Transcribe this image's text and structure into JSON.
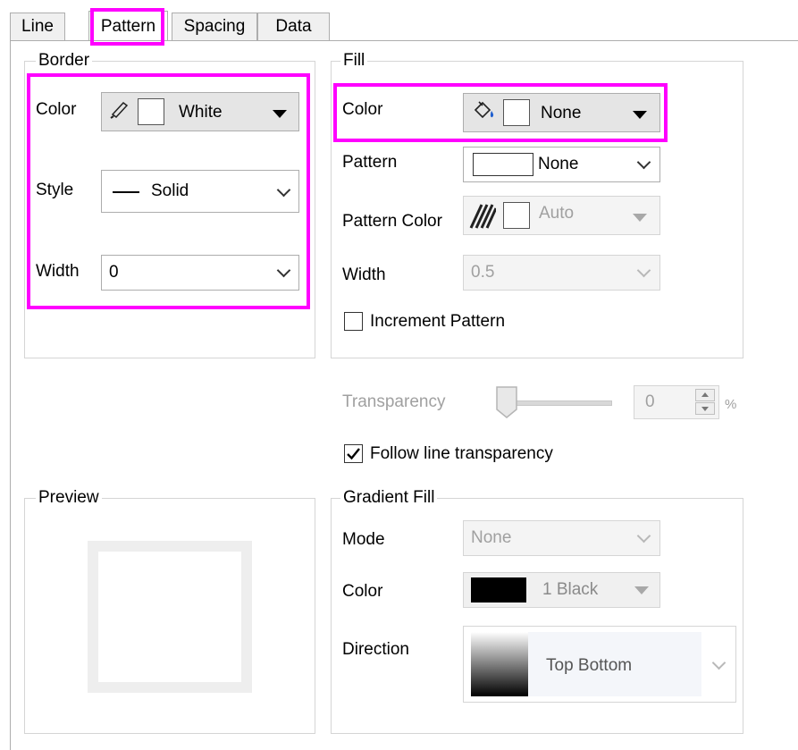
{
  "tabs": [
    {
      "label": "Line"
    },
    {
      "label": "Pattern"
    },
    {
      "label": "Spacing"
    },
    {
      "label": "Data"
    }
  ],
  "border": {
    "title": "Border",
    "color_label": "Color",
    "color_value": "White",
    "style_label": "Style",
    "style_value": "Solid",
    "width_label": "Width",
    "width_value": "0"
  },
  "fill": {
    "title": "Fill",
    "color_label": "Color",
    "color_value": "None",
    "pattern_label": "Pattern",
    "pattern_value": "None",
    "pattern_color_label": "Pattern Color",
    "pattern_color_value": "Auto",
    "width_label": "Width",
    "width_value": "0.5",
    "increment_label": "Increment Pattern",
    "increment_checked": false
  },
  "transparency": {
    "label": "Transparency",
    "value": "0",
    "unit": "%",
    "follow_label": "Follow line transparency",
    "follow_checked": true
  },
  "preview": {
    "title": "Preview"
  },
  "gradient": {
    "title": "Gradient Fill",
    "mode_label": "Mode",
    "mode_value": "None",
    "color_label": "Color",
    "color_value": "1 Black",
    "direction_label": "Direction",
    "direction_value": "Top Bottom"
  },
  "colors": {
    "highlight": "#ff00ff",
    "swatch_black": "#000000"
  }
}
